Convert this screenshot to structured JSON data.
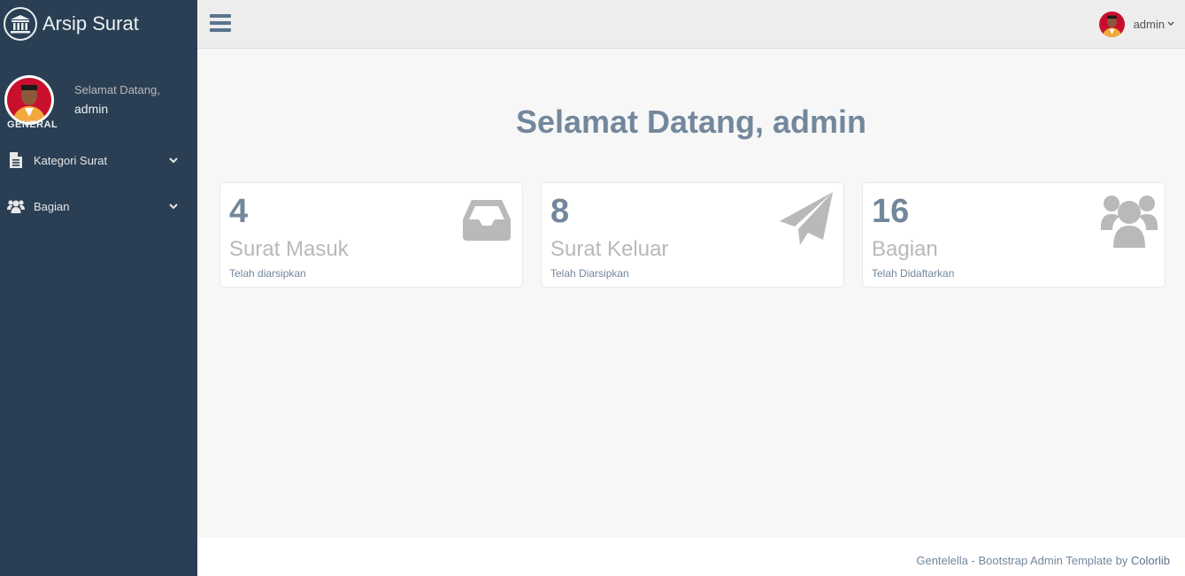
{
  "app": {
    "title": "Arsip Surat",
    "logo_icon": "institution-icon"
  },
  "sidebar": {
    "welcome": "Selamat Datang,",
    "username": "admin",
    "section_title": "GENERAL",
    "items": [
      {
        "label": "Kategori Surat",
        "icon": "file-text-icon"
      },
      {
        "label": "Bagian",
        "icon": "users-icon"
      }
    ]
  },
  "topnav": {
    "toggle_icon": "menu-bars-icon",
    "username": "admin"
  },
  "main": {
    "heading": "Selamat Datang, admin",
    "tiles": [
      {
        "count": "4",
        "title": "Surat Masuk",
        "subtitle": "Telah diarsipkan",
        "icon": "inbox-icon"
      },
      {
        "count": "8",
        "title": "Surat Keluar",
        "subtitle": "Telah Diarsipkan",
        "icon": "paper-plane-icon"
      },
      {
        "count": "16",
        "title": "Bagian",
        "subtitle": "Telah Didaftarkan",
        "icon": "users-icon"
      }
    ]
  },
  "footer": {
    "text": "Gentelella - Bootstrap Admin Template by ",
    "link": "Colorlib"
  },
  "colors": {
    "sidebar_bg": "#2A3F54",
    "topnav_bg": "#EDEDED",
    "page_bg": "#F7F7F7",
    "accent_text": "#73879C",
    "muted_text": "#BAB8B8"
  }
}
